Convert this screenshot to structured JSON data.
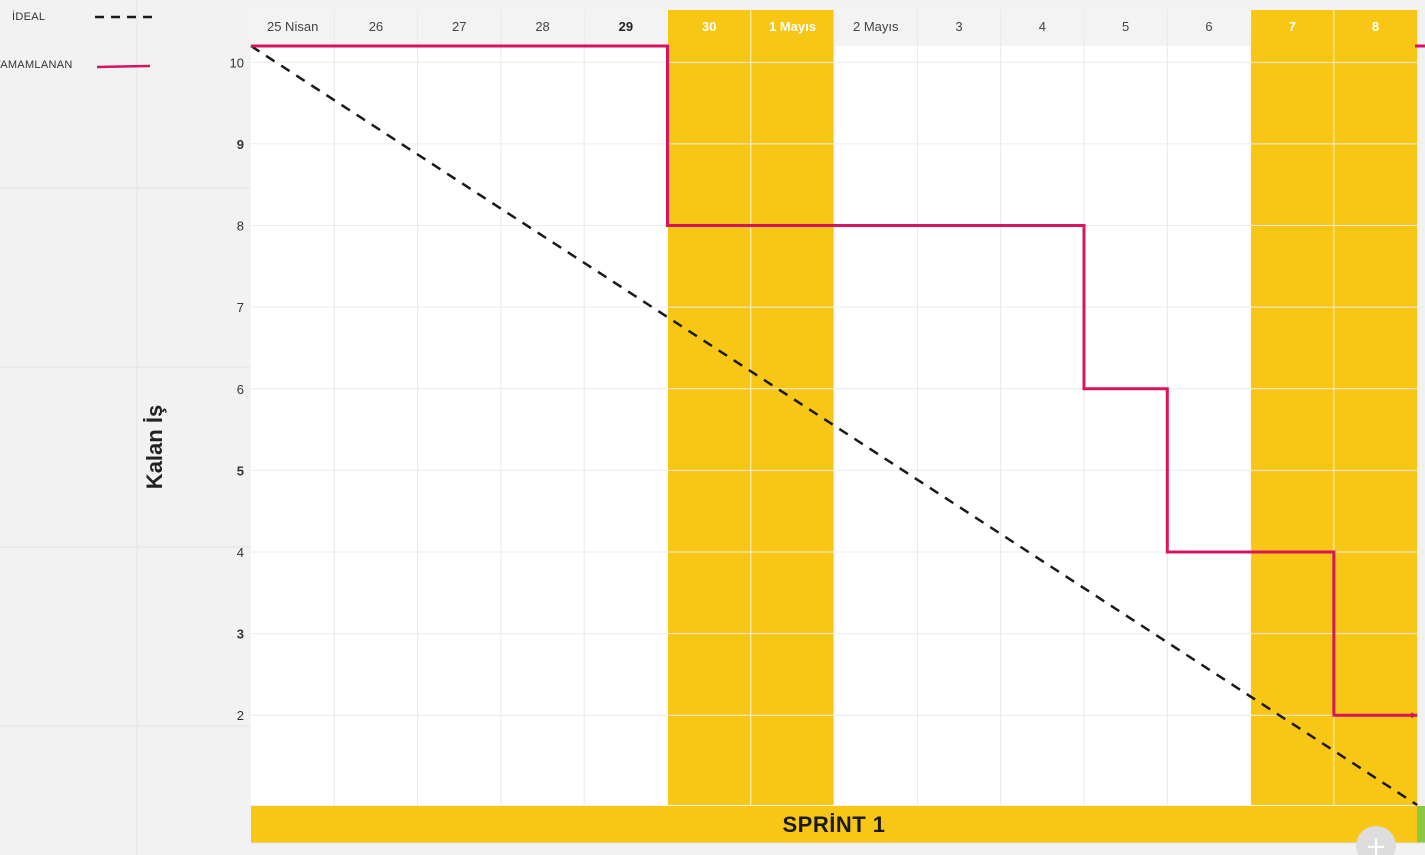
{
  "legend": {
    "ideal_label": "İDEAL",
    "completed_label": "TAMAMLANAN"
  },
  "colors": {
    "ideal": "#1a1a1a",
    "completed": "#d6145f",
    "weekend": "#f8c614",
    "sprint_bar": "#f8c614",
    "grid": "#e8e8e8"
  },
  "sprint": {
    "label": "SPRİNT 1"
  },
  "chart_data": {
    "type": "line",
    "xlabel": "",
    "ylabel": "Kalan İş",
    "categories": [
      "25 Nisan",
      "26",
      "27",
      "28",
      "29",
      "30",
      "1 Mayıs",
      "2 Mayıs",
      "3",
      "4",
      "5",
      "6",
      "7",
      "8"
    ],
    "category_styles": [
      "normal",
      "normal",
      "normal",
      "normal",
      "bold",
      "weekend",
      "weekend",
      "normal",
      "normal",
      "normal",
      "normal",
      "normal",
      "weekend",
      "weekend"
    ],
    "y_ticks": [
      10,
      9,
      8,
      7,
      6,
      5,
      4,
      3,
      2
    ],
    "y_ticks_bold": [
      9,
      5,
      3
    ],
    "ylim": [
      0.9,
      10.2
    ],
    "grid": true,
    "legend_position": "top-left",
    "series": [
      {
        "name": "İDEAL",
        "style": "dashed",
        "x": [
          0,
          14
        ],
        "y": [
          10.2,
          0.9
        ]
      },
      {
        "name": "TAMAMLANAN",
        "style": "step",
        "x": [
          0,
          5,
          10,
          11,
          13,
          14
        ],
        "y": [
          10.2,
          8,
          6,
          4,
          2,
          2
        ]
      }
    ]
  }
}
